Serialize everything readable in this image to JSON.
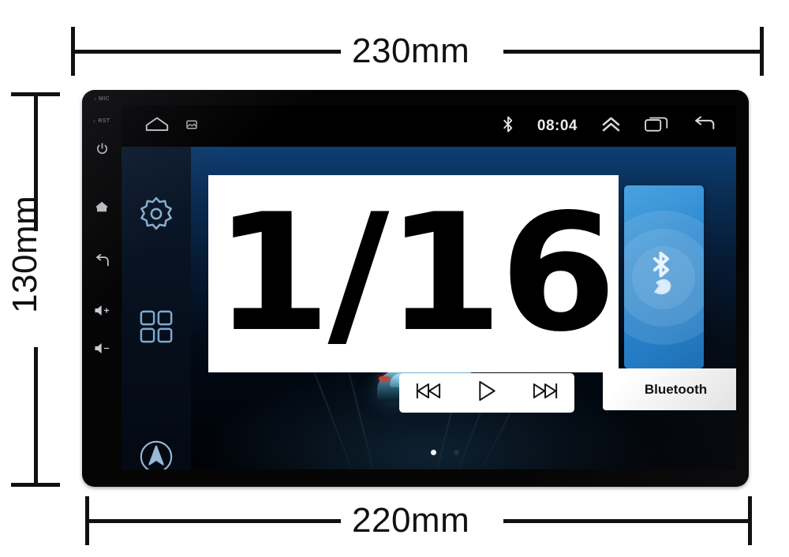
{
  "dimensions": {
    "top": {
      "label": "230mm",
      "value": 230,
      "unit": "mm",
      "orientation": "horizontal",
      "position": "top"
    },
    "bottom": {
      "label": "220mm",
      "value": 220,
      "unit": "mm",
      "orientation": "horizontal",
      "position": "bottom"
    },
    "left": {
      "label": "130mm",
      "value": 130,
      "unit": "mm",
      "orientation": "vertical",
      "position": "left"
    }
  },
  "device": {
    "type": "car-head-unit",
    "bezel_color": "#050505",
    "hardware_buttons": [
      {
        "name": "mic",
        "label": "MIC",
        "kind": "text-pinhole"
      },
      {
        "name": "reset",
        "label": "RST",
        "kind": "text-pinhole"
      },
      {
        "name": "power",
        "label": "",
        "kind": "icon"
      },
      {
        "name": "home",
        "label": "",
        "kind": "icon"
      },
      {
        "name": "back",
        "label": "",
        "kind": "icon"
      },
      {
        "name": "volume-up",
        "label": "",
        "kind": "icon"
      },
      {
        "name": "volume-down",
        "label": "",
        "kind": "icon"
      }
    ]
  },
  "screen": {
    "statusbar": {
      "time": "08:04",
      "left_icons": [
        "home-icon",
        "screenshot-icon"
      ],
      "right_icons": [
        "bluetooth-icon",
        "chevron-up-icon",
        "recent-apps-icon",
        "back-icon"
      ]
    },
    "dock": [
      {
        "name": "settings",
        "icon": "gear-icon"
      },
      {
        "name": "apps",
        "icon": "grid-apps-icon"
      },
      {
        "name": "navigation",
        "icon": "navigation-compass-icon"
      }
    ],
    "widgets": {
      "bluetooth": {
        "label": "Bluetooth",
        "icon": "bluetooth-phone-icon",
        "tile_color": "#2f8ad0"
      },
      "media": {
        "buttons": [
          {
            "name": "previous",
            "icon": "skip-previous-icon"
          },
          {
            "name": "play",
            "icon": "play-icon"
          },
          {
            "name": "next",
            "icon": "skip-next-icon"
          }
        ]
      }
    },
    "page_indicator": {
      "total": 2,
      "active": 1
    },
    "wallpaper": {
      "subject": "car",
      "accent_color": "#0d3e74"
    }
  },
  "watermark": {
    "text": "1/16"
  }
}
